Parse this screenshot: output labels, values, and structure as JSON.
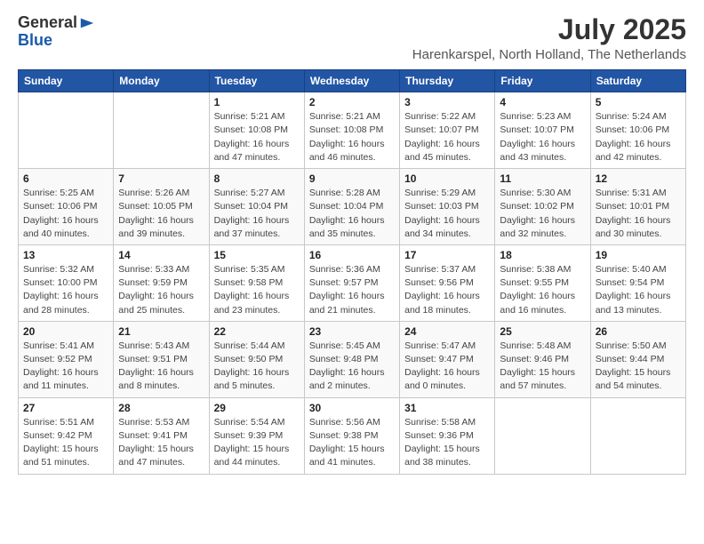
{
  "header": {
    "logo": {
      "general": "General",
      "blue": "Blue",
      "icon": "▶"
    },
    "title": "July 2025",
    "location": "Harenkarspel, North Holland, The Netherlands"
  },
  "weekdays": [
    "Sunday",
    "Monday",
    "Tuesday",
    "Wednesday",
    "Thursday",
    "Friday",
    "Saturday"
  ],
  "weeks": [
    [
      {
        "day": "",
        "info": ""
      },
      {
        "day": "",
        "info": ""
      },
      {
        "day": "1",
        "info": "Sunrise: 5:21 AM\nSunset: 10:08 PM\nDaylight: 16 hours and 47 minutes."
      },
      {
        "day": "2",
        "info": "Sunrise: 5:21 AM\nSunset: 10:08 PM\nDaylight: 16 hours and 46 minutes."
      },
      {
        "day": "3",
        "info": "Sunrise: 5:22 AM\nSunset: 10:07 PM\nDaylight: 16 hours and 45 minutes."
      },
      {
        "day": "4",
        "info": "Sunrise: 5:23 AM\nSunset: 10:07 PM\nDaylight: 16 hours and 43 minutes."
      },
      {
        "day": "5",
        "info": "Sunrise: 5:24 AM\nSunset: 10:06 PM\nDaylight: 16 hours and 42 minutes."
      }
    ],
    [
      {
        "day": "6",
        "info": "Sunrise: 5:25 AM\nSunset: 10:06 PM\nDaylight: 16 hours and 40 minutes."
      },
      {
        "day": "7",
        "info": "Sunrise: 5:26 AM\nSunset: 10:05 PM\nDaylight: 16 hours and 39 minutes."
      },
      {
        "day": "8",
        "info": "Sunrise: 5:27 AM\nSunset: 10:04 PM\nDaylight: 16 hours and 37 minutes."
      },
      {
        "day": "9",
        "info": "Sunrise: 5:28 AM\nSunset: 10:04 PM\nDaylight: 16 hours and 35 minutes."
      },
      {
        "day": "10",
        "info": "Sunrise: 5:29 AM\nSunset: 10:03 PM\nDaylight: 16 hours and 34 minutes."
      },
      {
        "day": "11",
        "info": "Sunrise: 5:30 AM\nSunset: 10:02 PM\nDaylight: 16 hours and 32 minutes."
      },
      {
        "day": "12",
        "info": "Sunrise: 5:31 AM\nSunset: 10:01 PM\nDaylight: 16 hours and 30 minutes."
      }
    ],
    [
      {
        "day": "13",
        "info": "Sunrise: 5:32 AM\nSunset: 10:00 PM\nDaylight: 16 hours and 28 minutes."
      },
      {
        "day": "14",
        "info": "Sunrise: 5:33 AM\nSunset: 9:59 PM\nDaylight: 16 hours and 25 minutes."
      },
      {
        "day": "15",
        "info": "Sunrise: 5:35 AM\nSunset: 9:58 PM\nDaylight: 16 hours and 23 minutes."
      },
      {
        "day": "16",
        "info": "Sunrise: 5:36 AM\nSunset: 9:57 PM\nDaylight: 16 hours and 21 minutes."
      },
      {
        "day": "17",
        "info": "Sunrise: 5:37 AM\nSunset: 9:56 PM\nDaylight: 16 hours and 18 minutes."
      },
      {
        "day": "18",
        "info": "Sunrise: 5:38 AM\nSunset: 9:55 PM\nDaylight: 16 hours and 16 minutes."
      },
      {
        "day": "19",
        "info": "Sunrise: 5:40 AM\nSunset: 9:54 PM\nDaylight: 16 hours and 13 minutes."
      }
    ],
    [
      {
        "day": "20",
        "info": "Sunrise: 5:41 AM\nSunset: 9:52 PM\nDaylight: 16 hours and 11 minutes."
      },
      {
        "day": "21",
        "info": "Sunrise: 5:43 AM\nSunset: 9:51 PM\nDaylight: 16 hours and 8 minutes."
      },
      {
        "day": "22",
        "info": "Sunrise: 5:44 AM\nSunset: 9:50 PM\nDaylight: 16 hours and 5 minutes."
      },
      {
        "day": "23",
        "info": "Sunrise: 5:45 AM\nSunset: 9:48 PM\nDaylight: 16 hours and 2 minutes."
      },
      {
        "day": "24",
        "info": "Sunrise: 5:47 AM\nSunset: 9:47 PM\nDaylight: 16 hours and 0 minutes."
      },
      {
        "day": "25",
        "info": "Sunrise: 5:48 AM\nSunset: 9:46 PM\nDaylight: 15 hours and 57 minutes."
      },
      {
        "day": "26",
        "info": "Sunrise: 5:50 AM\nSunset: 9:44 PM\nDaylight: 15 hours and 54 minutes."
      }
    ],
    [
      {
        "day": "27",
        "info": "Sunrise: 5:51 AM\nSunset: 9:42 PM\nDaylight: 15 hours and 51 minutes."
      },
      {
        "day": "28",
        "info": "Sunrise: 5:53 AM\nSunset: 9:41 PM\nDaylight: 15 hours and 47 minutes."
      },
      {
        "day": "29",
        "info": "Sunrise: 5:54 AM\nSunset: 9:39 PM\nDaylight: 15 hours and 44 minutes."
      },
      {
        "day": "30",
        "info": "Sunrise: 5:56 AM\nSunset: 9:38 PM\nDaylight: 15 hours and 41 minutes."
      },
      {
        "day": "31",
        "info": "Sunrise: 5:58 AM\nSunset: 9:36 PM\nDaylight: 15 hours and 38 minutes."
      },
      {
        "day": "",
        "info": ""
      },
      {
        "day": "",
        "info": ""
      }
    ]
  ]
}
